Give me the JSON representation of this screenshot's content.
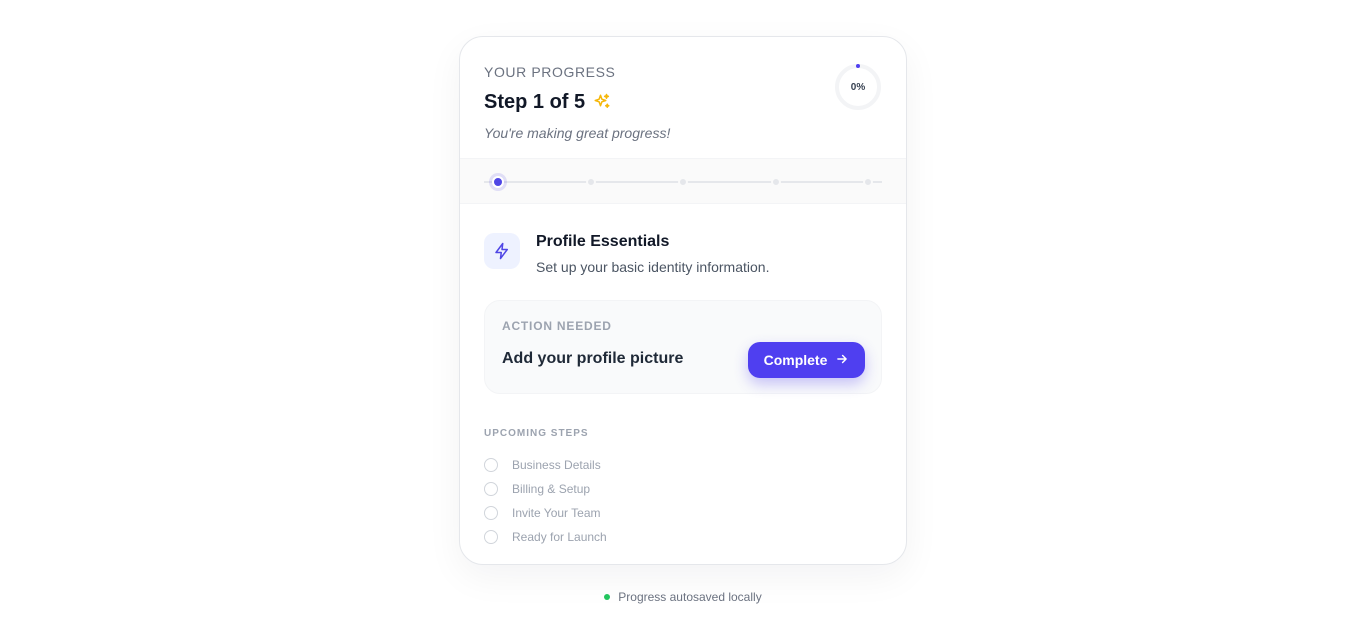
{
  "header": {
    "eyebrow": "YOUR PROGRESS",
    "step_title": "Step 1 of 5",
    "subtitle": "You're making great progress!",
    "progress_label": "0%",
    "progress_value": 0
  },
  "stepper": {
    "total_steps": 5,
    "current_index": 0
  },
  "current_step": {
    "icon": "lightning-bolt-icon",
    "name": "Profile Essentials",
    "description": "Set up your basic identity information.",
    "action_label": "ACTION NEEDED",
    "action_text": "Add your profile picture",
    "button_label": "Complete"
  },
  "upcoming": {
    "title": "UPCOMING STEPS",
    "items": [
      "Business Details",
      "Billing & Setup",
      "Invite Your Team",
      "Ready for Launch"
    ]
  },
  "footer": {
    "status": "Progress autosaved locally"
  },
  "colors": {
    "accent": "#4f3ff0",
    "status_ok": "#22c55e",
    "sparkle": "#f5b70a"
  }
}
